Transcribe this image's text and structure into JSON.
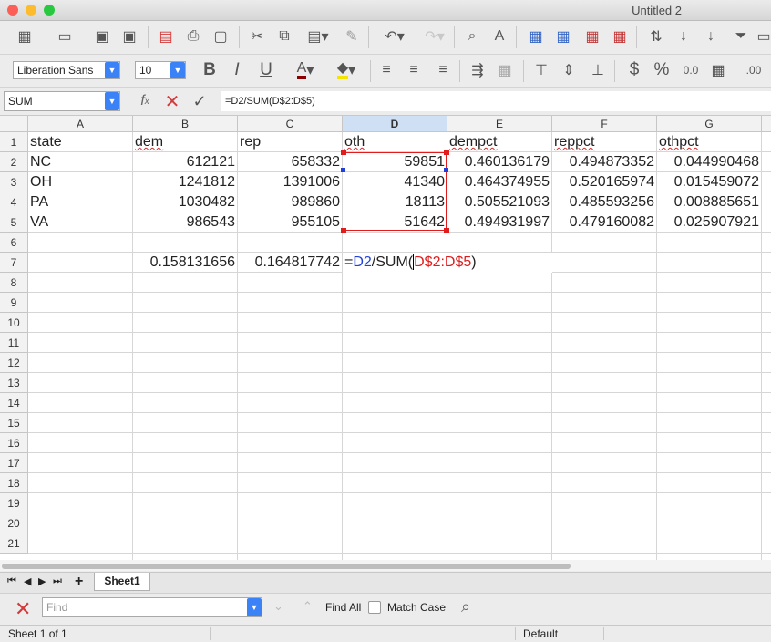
{
  "window": {
    "title": "Untitled 2"
  },
  "format": {
    "font_name": "Liberation Sans",
    "font_size": "10"
  },
  "formula_bar": {
    "name_box": "SUM",
    "formula": "=D2/SUM(D$2:D$5)"
  },
  "columns": [
    "A",
    "B",
    "C",
    "D",
    "E",
    "F",
    "G"
  ],
  "rows": [
    "1",
    "2",
    "3",
    "4",
    "5",
    "6",
    "7",
    "8",
    "9",
    "10",
    "11",
    "12",
    "13",
    "14",
    "15",
    "16",
    "17",
    "18",
    "19",
    "20",
    "21"
  ],
  "cells": {
    "r1": [
      "state",
      "dem",
      "rep",
      "oth",
      "dempct",
      "reppct",
      "othpct"
    ],
    "r2": [
      "NC",
      "612121",
      "658332",
      "59851",
      "0.460136179",
      "0.494873352",
      "0.044990468"
    ],
    "r3": [
      "OH",
      "1241812",
      "1391006",
      "41340",
      "0.464374955",
      "0.520165974",
      "0.015459072"
    ],
    "r4": [
      "PA",
      "1030482",
      "989860",
      "18113",
      "0.505521093",
      "0.485593256",
      "0.008885651"
    ],
    "r5": [
      "VA",
      "986543",
      "955105",
      "51642",
      "0.494931997",
      "0.479160082",
      "0.025907921"
    ],
    "r7": {
      "B": "0.158131656",
      "C": "0.164817742",
      "D_eq": "=",
      "D_ref1": "D2",
      "D_mid": "/SUM(",
      "D_ref2": "D$2:D$5",
      "D_end": ")"
    }
  },
  "sheet_tabs": [
    "Sheet1"
  ],
  "find": {
    "placeholder": "Find",
    "find_all": "Find All",
    "match_case": "Match Case"
  },
  "status": {
    "sheet": "Sheet 1 of 1",
    "style": "Default"
  },
  "colors": {
    "accent": "#3b82f6",
    "selection": "#cfe0f5",
    "ref_blue": "#1f3fd8",
    "ref_red": "#e01c1c"
  }
}
